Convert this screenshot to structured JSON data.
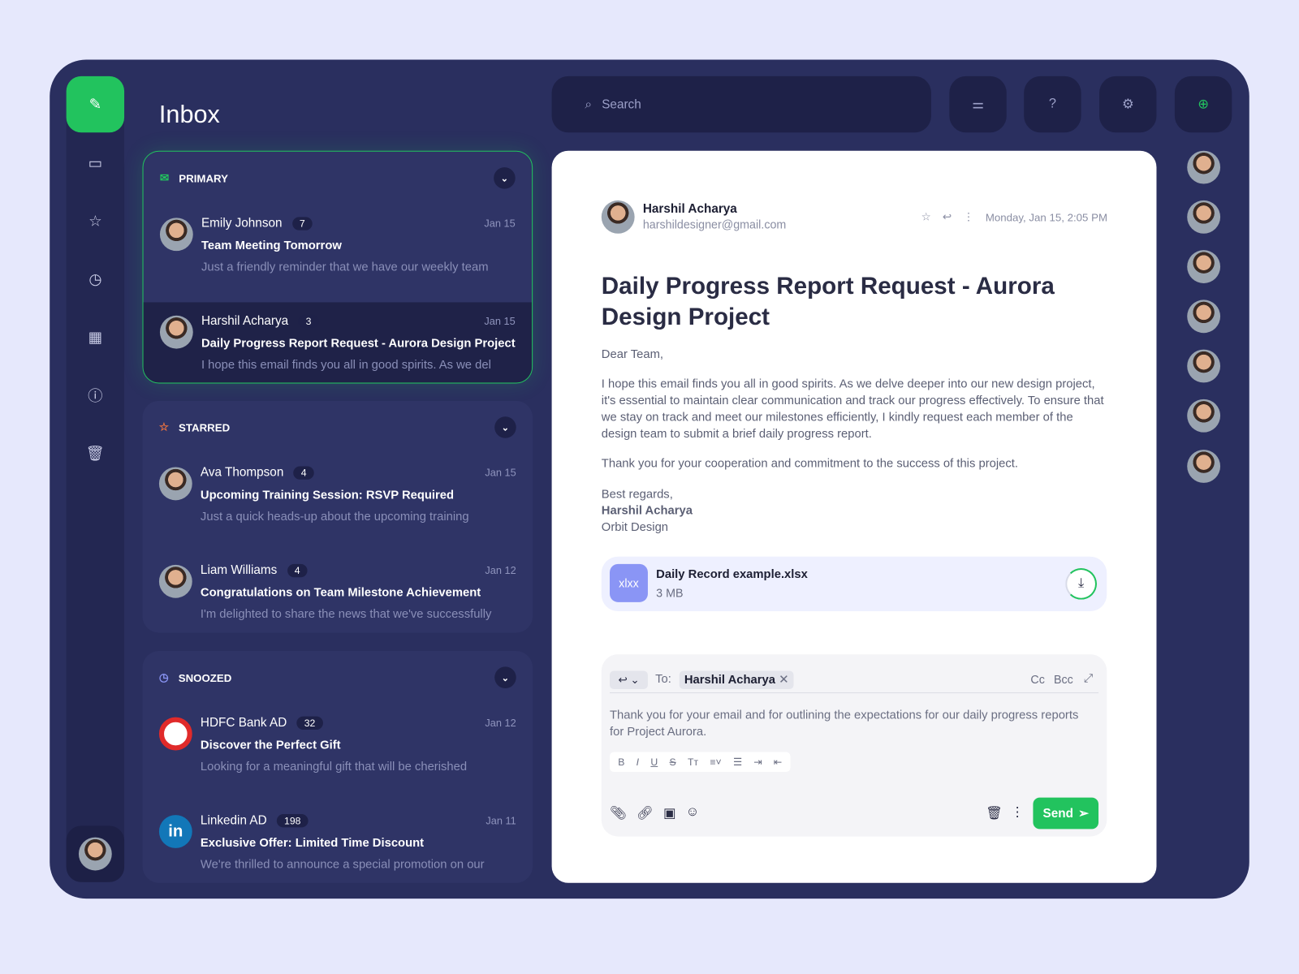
{
  "colors": {
    "accent": "#22c35e",
    "background": "#e6e8fc",
    "panel": "#2a2f5f"
  },
  "header": {
    "title": "Inbox",
    "search_placeholder": "Search"
  },
  "rail": {
    "icons": [
      "pencil-icon",
      "inbox-icon",
      "star-icon",
      "clock-icon",
      "calendar-icon",
      "alert-icon",
      "trash-icon"
    ]
  },
  "sections": [
    {
      "label": "PRIMARY",
      "icon": "mail-icon",
      "items": [
        {
          "name": "Emily Johnson",
          "count": "7",
          "date": "Jan 15",
          "subject": "Team Meeting Tomorrow",
          "preview": "Just a friendly reminder that we have our weekly team"
        },
        {
          "name": "Harshil Acharya",
          "count": "3",
          "date": "Jan 15",
          "subject": "Daily Progress Report Request - Aurora Design Project",
          "preview": "I hope this email finds you all in good spirits. As we del"
        }
      ]
    },
    {
      "label": "STARRED",
      "icon": "star-icon",
      "items": [
        {
          "name": "Ava Thompson",
          "count": "4",
          "date": "Jan 15",
          "subject": "Upcoming Training Session: RSVP Required",
          "preview": "Just a quick heads-up about the upcoming training"
        },
        {
          "name": "Liam Williams",
          "count": "4",
          "date": "Jan 12",
          "subject": "Congratulations on Team Milestone Achievement",
          "preview": "I'm delighted to share the news that we've successfully"
        }
      ]
    },
    {
      "label": "SNOOZED",
      "icon": "clock-icon",
      "items": [
        {
          "name": "HDFC Bank AD",
          "count": "32",
          "date": "Jan 12",
          "subject": "Discover the Perfect Gift",
          "preview": "Looking for a meaningful gift that will be cherished"
        },
        {
          "name": "Linkedin AD",
          "count": "198",
          "date": "Jan 11",
          "subject": "Exclusive Offer: Limited Time Discount",
          "preview": "We're thrilled to announce a special promotion on our"
        }
      ]
    }
  ],
  "mail": {
    "sender_name": "Harshil Acharya",
    "sender_email": "harshildesigner@gmail.com",
    "datetime": "Monday, Jan 15, 2:05 PM",
    "subject": "Daily Progress Report Request - Aurora Design Project",
    "greeting": "Dear Team,",
    "para1": "I hope this email finds you all in good spirits. As we delve deeper into our new design project, it's essential to maintain clear communication and track our progress effectively. To ensure that we stay on track and meet our milestones efficiently, I kindly request each member of the design team to submit a brief daily progress report.",
    "para2": "Thank you for your cooperation and commitment to the success of this project.",
    "signoff": "Best regards,",
    "sig_name": "Harshil Acharya",
    "sig_company": "Orbit Design",
    "attachment": {
      "ext": "xlxx",
      "name": "Daily Record example.xlsx",
      "size": "3 MB"
    }
  },
  "reply": {
    "to_label": "To:",
    "recipient": "Harshil Acharya",
    "cc": "Cc",
    "bcc": "Bcc",
    "body": "Thank you for your email and for outlining the expectations for our daily progress reports for Project Aurora.",
    "send_label": "Send",
    "format": [
      "B",
      "I",
      "U",
      "S",
      "Tт",
      "≡˅",
      "☰",
      "⇥",
      "⇤"
    ]
  }
}
